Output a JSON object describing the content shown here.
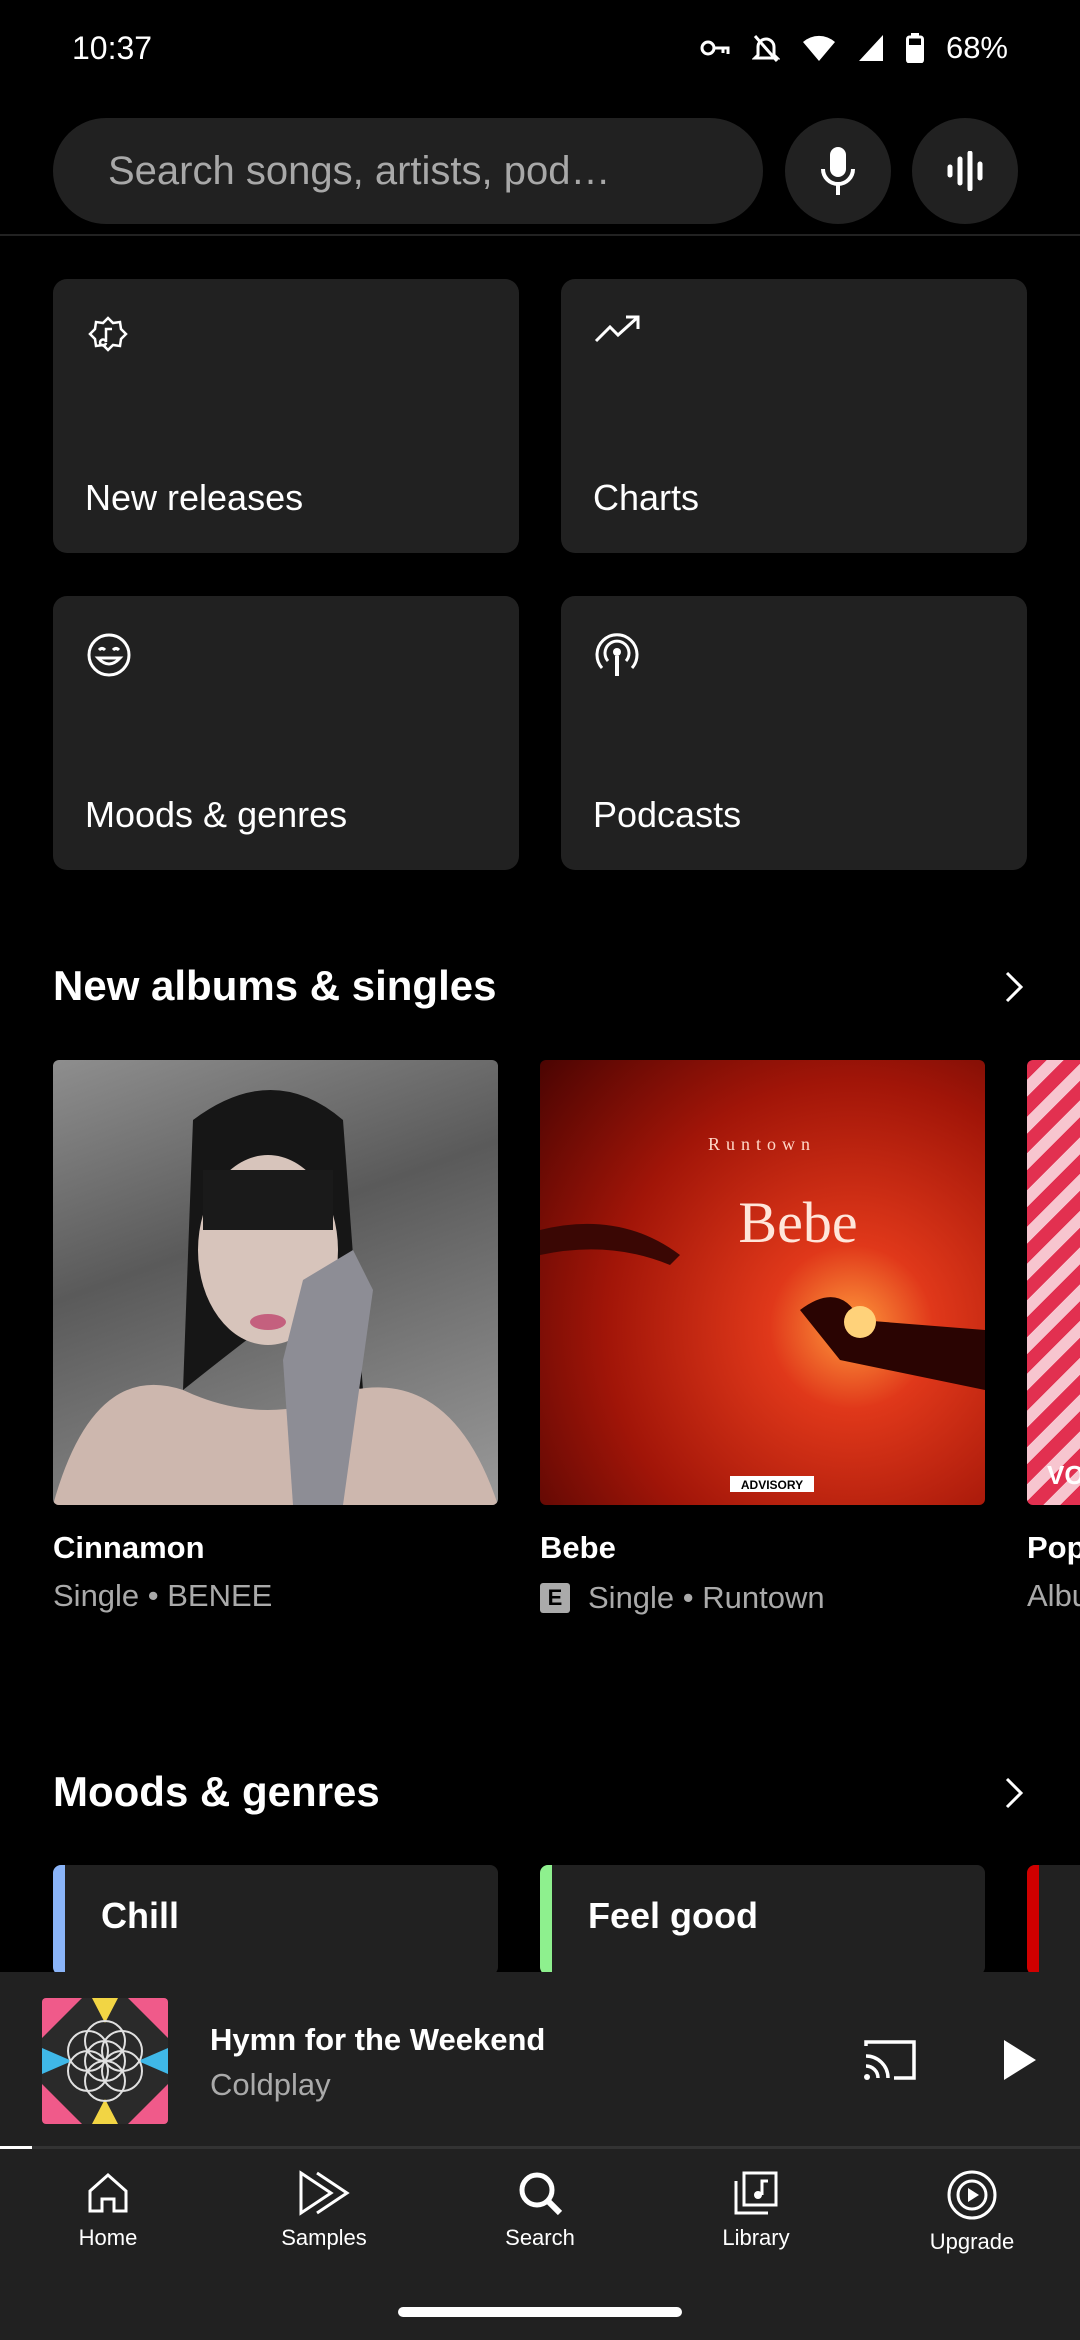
{
  "status_bar": {
    "time": "10:37",
    "battery": "68%"
  },
  "search": {
    "placeholder": "Search songs, artists, pod…"
  },
  "tiles": [
    {
      "label": "New releases",
      "icon": "new-releases-icon"
    },
    {
      "label": "Charts",
      "icon": "trending-icon"
    },
    {
      "label": "Moods & genres",
      "icon": "mood-icon"
    },
    {
      "label": "Podcasts",
      "icon": "podcast-icon"
    }
  ],
  "new_albums": {
    "title": "New albums & singles",
    "items": [
      {
        "title": "Cinnamon",
        "subtitle": "Single • BENEE",
        "explicit": false
      },
      {
        "title": "Bebe",
        "subtitle": "Single • Runtown",
        "explicit": true,
        "art_text_top": "Runtown",
        "art_text_main": "Bebe",
        "art_advisory": "ADVISORY"
      },
      {
        "title": "Pop",
        "subtitle": "Albu",
        "explicit": false,
        "art_text": "VO"
      }
    ],
    "explicit_badge": "E"
  },
  "moods": {
    "title": "Moods & genres",
    "items": [
      {
        "label": "Chill",
        "color": "#8ab4f8"
      },
      {
        "label": "Feel good",
        "color": "#8ef08e"
      },
      {
        "label": "",
        "color": "#d00000"
      }
    ]
  },
  "player": {
    "title": "Hymn for the Weekend",
    "artist": "Coldplay",
    "progress": 0.03
  },
  "nav": [
    {
      "label": "Home",
      "icon": "home-icon"
    },
    {
      "label": "Samples",
      "icon": "samples-icon"
    },
    {
      "label": "Search",
      "icon": "search-icon"
    },
    {
      "label": "Library",
      "icon": "library-icon"
    },
    {
      "label": "Upgrade",
      "icon": "upgrade-icon"
    }
  ]
}
